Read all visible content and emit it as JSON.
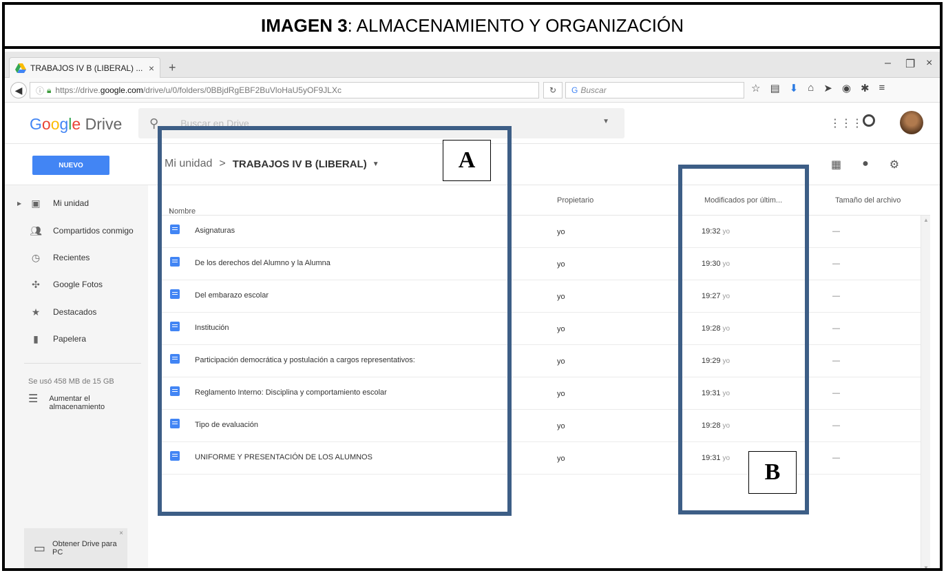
{
  "caption": {
    "bold": "IMAGEN 3",
    "rest": ": ALMACENAMIENTO Y ORGANIZACIÓN"
  },
  "browser": {
    "tab_title": "TRABAJOS IV B (LIBERAL) ...",
    "tab_close": "×",
    "new_tab": "+",
    "window_controls": {
      "minimize": "–",
      "maximize": "❐",
      "close": "×"
    },
    "url_prefix": "https://drive.",
    "url_host": "google.com",
    "url_path": "/drive/u/0/folders/0BBjdRgEBF2BuVloHaU5yOF9JLXc",
    "search_placeholder": "Buscar",
    "toolbar_icons": [
      "star-icon",
      "clipboard-icon",
      "download-icon",
      "home-icon",
      "send-icon",
      "pocket-icon",
      "extension-icon",
      "menu-icon"
    ]
  },
  "drive": {
    "logo": "Google",
    "logo_suffix": "Drive",
    "search_placeholder": "Buscar en Drive",
    "new_button": "NUEVO",
    "breadcrumb": {
      "root": "Mi unidad",
      "separator": ">",
      "current": "TRABAJOS IV B (LIBERAL)"
    },
    "sidebar": {
      "items": [
        {
          "label": "Mi unidad",
          "icon": "drive-icon"
        },
        {
          "label": "Compartidos conmigo",
          "icon": "people-icon"
        },
        {
          "label": "Recientes",
          "icon": "clock-icon"
        },
        {
          "label": "Google Fotos",
          "icon": "photos-icon"
        },
        {
          "label": "Destacados",
          "icon": "star-icon"
        },
        {
          "label": "Papelera",
          "icon": "trash-icon"
        }
      ],
      "storage": "Se usó 458 MB de 15 GB",
      "upgrade_line1": "Aumentar el",
      "upgrade_line2": "almacenamiento",
      "get_drive_line1": "Obtener Drive para",
      "get_drive_line2": "PC"
    },
    "columns": {
      "name": "Nombre",
      "owner": "Propietario",
      "modified": "Modificados por últim...",
      "size": "Tamaño del archivo"
    },
    "files": [
      {
        "name": "Asignaturas",
        "owner": "yo",
        "time": "19:32",
        "by": "yo",
        "size": "—"
      },
      {
        "name": "De los derechos del Alumno y la Alumna",
        "owner": "yo",
        "time": "19:30",
        "by": "yo",
        "size": "—"
      },
      {
        "name": "Del embarazo escolar",
        "owner": "yo",
        "time": "19:27",
        "by": "yo",
        "size": "—"
      },
      {
        "name": "Institución",
        "owner": "yo",
        "time": "19:28",
        "by": "yo",
        "size": "—"
      },
      {
        "name": "Participación democrática y postulación a cargos representativos:",
        "owner": "yo",
        "time": "19:29",
        "by": "yo",
        "size": "—"
      },
      {
        "name": "Reglamento Interno: Disciplina y comportamiento escolar",
        "owner": "yo",
        "time": "19:31",
        "by": "yo",
        "size": "—"
      },
      {
        "name": "Tipo de evaluación",
        "owner": "yo",
        "time": "19:28",
        "by": "yo",
        "size": "—"
      },
      {
        "name": "UNIFORME Y PRESENTACIÓN DE LOS ALUMNOS",
        "owner": "yo",
        "time": "19:31",
        "by": "yo",
        "size": "—"
      }
    ]
  },
  "annotations": {
    "a": "A",
    "b": "B"
  },
  "colors": {
    "accent": "#4285f4",
    "annotation_border": "#3d5e86"
  }
}
